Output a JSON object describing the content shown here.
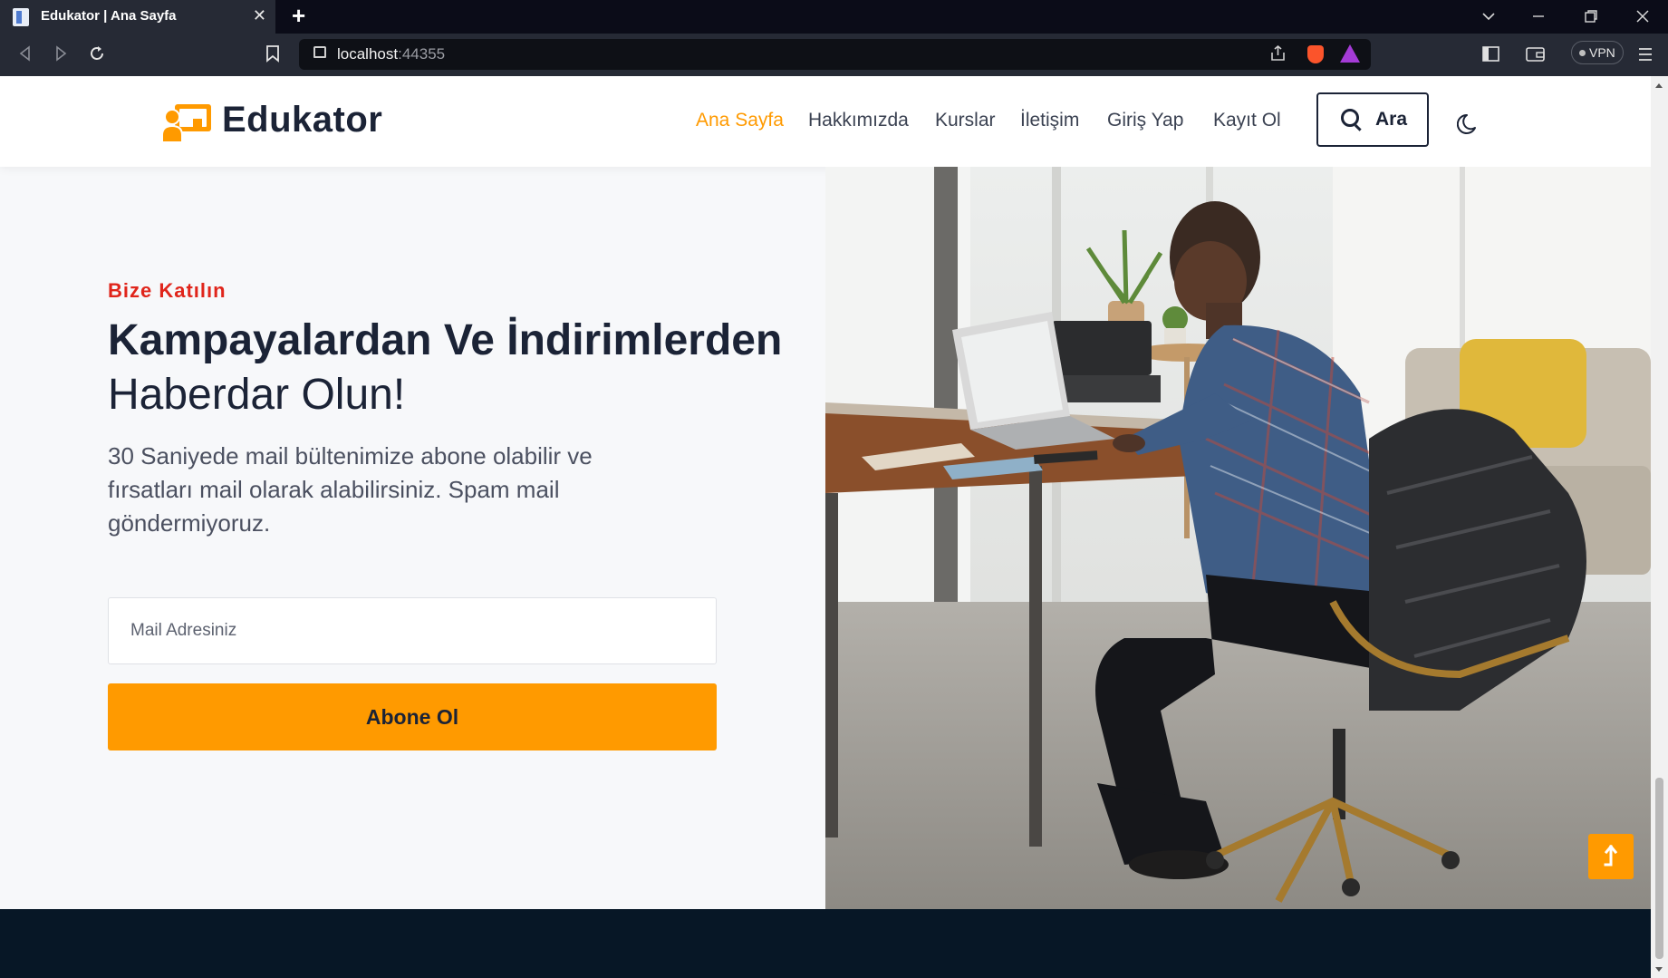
{
  "browser": {
    "tab_title": "Edukator | Ana Sayfa",
    "tab_close": "✕",
    "new_tab": "+",
    "url_host": "localhost",
    "url_port": ":44355",
    "vpn_label": "VPN"
  },
  "header": {
    "logo_text": "Edukator",
    "nav": [
      "Ana Sayfa",
      "Hakkımızda",
      "Kurslar",
      "İletişim",
      "Giriş Yap",
      "Kayıt Ol"
    ],
    "search_label": "Ara"
  },
  "hero": {
    "eyebrow": "Bize Katılın",
    "heading_bold": "Kampayalardan Ve İndirimlerden",
    "heading_light": "Haberdar Olun!",
    "lead": "30 Saniyede mail bültenimize abone olabilir ve fırsatları mail olarak alabilirsiniz. Spam mail göndermiyoruz.",
    "email_placeholder": "Mail Adresiniz",
    "subscribe_label": "Abone Ol"
  },
  "colors": {
    "accent": "#ff9a00",
    "heading": "#1b2336",
    "eyebrow": "#e0251b",
    "footer": "#071726"
  }
}
